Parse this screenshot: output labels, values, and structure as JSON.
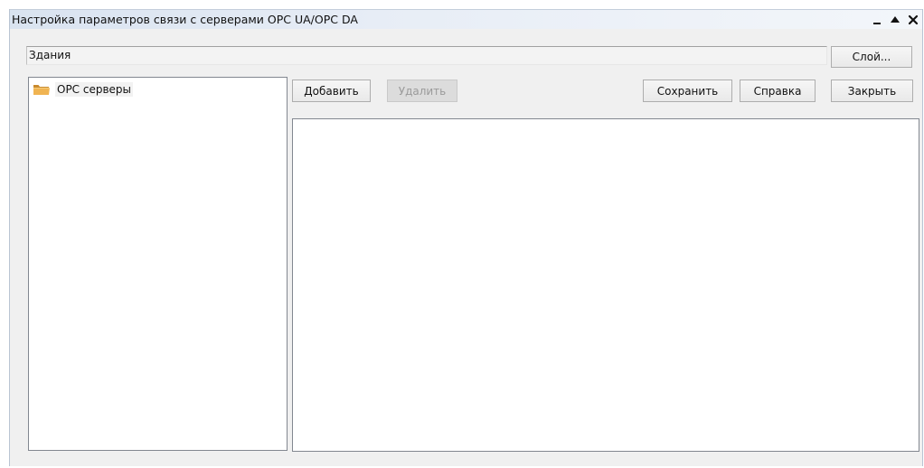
{
  "window": {
    "title": "Настройка параметров связи с серверами OPC UA/OPC DA"
  },
  "layer": {
    "path_value": "Здания",
    "layer_button_label": "Слой..."
  },
  "toolbar": {
    "add_label": "Добавить",
    "delete_label": "Удалить",
    "save_label": "Сохранить",
    "help_label": "Справка",
    "close_label": "Закрыть"
  },
  "tree": {
    "items": [
      {
        "label": "OPC серверы",
        "icon": "folder-icon"
      }
    ]
  },
  "icons": {
    "minimize": "minimize-icon",
    "maximize": "maximize-icon",
    "close": "close-icon"
  },
  "colors": {
    "folder": "#e8a94a",
    "titlebar": "#dce5f1",
    "window_bg": "#f0f0f0"
  }
}
